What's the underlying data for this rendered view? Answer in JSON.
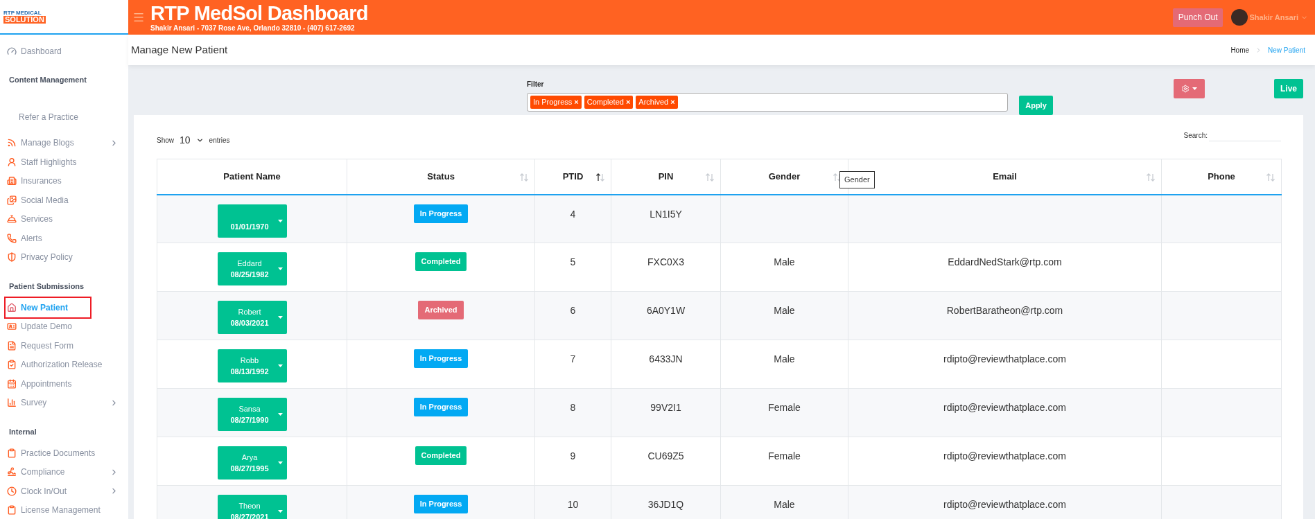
{
  "logo": {
    "line1": "RTP MEDICAL",
    "line2": "SOLUTION"
  },
  "header": {
    "title": "RTP MedSol Dashboard",
    "subtitle": "Shakir Ansari - 7037 Rose Ave, Orlando 32810 - (407) 617-2692",
    "punch_out": "Punch Out",
    "user_name": "Shakir Ansari"
  },
  "sidebar": {
    "items": [
      {
        "kind": "link",
        "label": "Dashboard",
        "selected": false
      },
      {
        "kind": "section",
        "label": "Content Management"
      },
      {
        "kind": "plain",
        "label": "Refer a Practice",
        "selected": false
      },
      {
        "kind": "link",
        "label": "Manage Blogs",
        "selected": false,
        "expandable": true
      },
      {
        "kind": "link",
        "label": "Staff Highlights",
        "selected": false
      },
      {
        "kind": "link",
        "label": "Insurances",
        "selected": false
      },
      {
        "kind": "link",
        "label": "Social Media",
        "selected": false
      },
      {
        "kind": "link",
        "label": "Services",
        "selected": false
      },
      {
        "kind": "link",
        "label": "Alerts",
        "selected": false
      },
      {
        "kind": "link",
        "label": "Privacy Policy",
        "selected": false
      },
      {
        "kind": "section",
        "label": "Patient Submissions"
      },
      {
        "kind": "link",
        "label": "New Patient",
        "selected": true
      },
      {
        "kind": "link",
        "label": "Update Demo",
        "selected": false
      },
      {
        "kind": "link",
        "label": "Request Form",
        "selected": false
      },
      {
        "kind": "link",
        "label": "Authorization Release",
        "selected": false
      },
      {
        "kind": "link",
        "label": "Appointments",
        "selected": false
      },
      {
        "kind": "link",
        "label": "Survey",
        "selected": false,
        "expandable": true
      },
      {
        "kind": "section",
        "label": "Internal"
      },
      {
        "kind": "link",
        "label": "Practice Documents",
        "selected": false
      },
      {
        "kind": "link",
        "label": "Compliance",
        "selected": false,
        "expandable": true
      },
      {
        "kind": "link",
        "label": "Clock In/Out",
        "selected": false,
        "expandable": true
      },
      {
        "kind": "link",
        "label": "License Management",
        "selected": false
      }
    ]
  },
  "page_header": {
    "title": "Manage New Patient",
    "breadcrumb": [
      {
        "label": "Home",
        "selected": false
      },
      {
        "label": "New Patient",
        "selected": true
      }
    ]
  },
  "filter": {
    "label": "Filter",
    "tags": [
      {
        "label": "In Progress",
        "remove": "×"
      },
      {
        "label": "Completed",
        "remove": "×"
      },
      {
        "label": "Archived",
        "remove": "×"
      }
    ],
    "apply": "Apply"
  },
  "live_button": "Live",
  "table": {
    "show_label": "Show",
    "page_size": "10",
    "entries_label": "entries",
    "search_label": "Search:",
    "tooltip": "Gender",
    "columns": [
      {
        "label": "Patient Name"
      },
      {
        "label": "Status",
        "sorted": false
      },
      {
        "label": "PTID",
        "sorted": true
      },
      {
        "label": "PIN",
        "sorted": false
      },
      {
        "label": "Gender",
        "sorted": false
      },
      {
        "label": "Email",
        "sorted": false
      },
      {
        "label": "Phone",
        "sorted": false
      }
    ],
    "rows": [
      {
        "dob": "01/01/1970",
        "status": {
          "label": "In Progress",
          "kind": "in_progress"
        },
        "ptid": "4",
        "pin": "LN1I5Y"
      },
      {
        "name": "Eddard",
        "dob": "08/25/1982",
        "status": {
          "label": "Completed",
          "kind": "completed"
        },
        "ptid": "5",
        "pin": "FXC0X3",
        "gender": "Male",
        "email": "EddardNedStark@rtp.com"
      },
      {
        "name": "Robert",
        "dob": "08/03/2021",
        "status": {
          "label": "Archived",
          "kind": "archived"
        },
        "ptid": "6",
        "pin": "6A0Y1W",
        "gender": "Male",
        "email": "RobertBaratheon@rtp.com"
      },
      {
        "name": "Robb",
        "dob": "08/13/1992",
        "status": {
          "label": "In Progress",
          "kind": "in_progress"
        },
        "ptid": "7",
        "pin": "6433JN",
        "gender": "Male",
        "email": "rdipto@reviewthatplace.com"
      },
      {
        "name": "Sansa",
        "dob": "08/27/1990",
        "status": {
          "label": "In Progress",
          "kind": "in_progress"
        },
        "ptid": "8",
        "pin": "99V2I1",
        "gender": "Female",
        "email": "rdipto@reviewthatplace.com"
      },
      {
        "name": "Arya",
        "dob": "08/27/1995",
        "status": {
          "label": "Completed",
          "kind": "completed"
        },
        "ptid": "9",
        "pin": "CU69Z5",
        "gender": "Female",
        "email": "rdipto@reviewthatplace.com"
      },
      {
        "name": "Theon",
        "dob": "08/27/2021",
        "status": {
          "label": "In Progress",
          "kind": "in_progress"
        },
        "ptid": "10",
        "pin": "36JD1Q",
        "gender": "Male",
        "email": "rdipto@reviewthatplace.com"
      }
    ]
  }
}
